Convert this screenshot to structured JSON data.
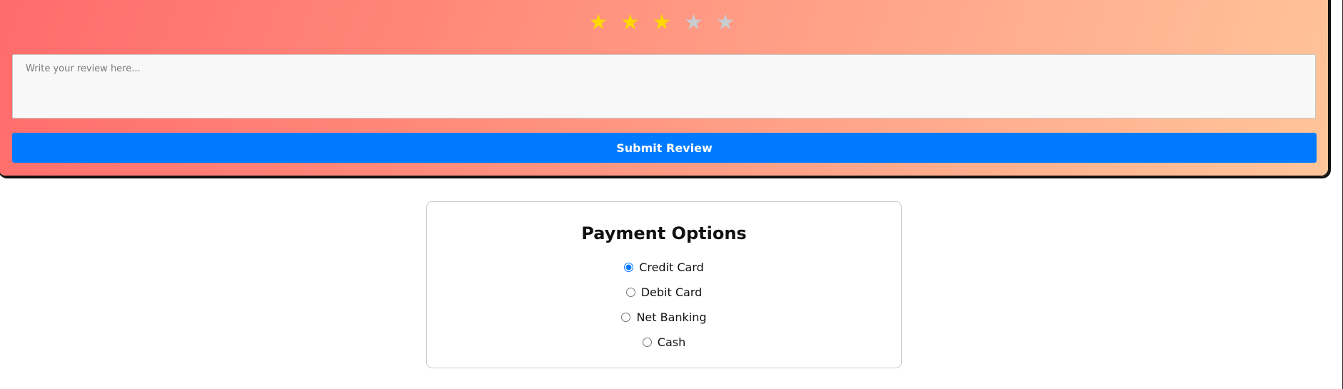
{
  "review": {
    "stars": {
      "rating": 3,
      "max": 5,
      "glyph": "★",
      "filled_color": "#FFD700",
      "empty_color": "#C9CCD1"
    },
    "textarea": {
      "placeholder": "Write your review here...",
      "value": ""
    },
    "submit_label": "Submit Review",
    "gradient_start": "#FF6B6B",
    "gradient_end": "#FFC59A",
    "button_color": "#007BFF"
  },
  "payment": {
    "title": "Payment Options",
    "selected": "credit-card",
    "options": [
      {
        "id": "credit-card",
        "label": "Credit Card"
      },
      {
        "id": "debit-card",
        "label": "Debit Card"
      },
      {
        "id": "net-banking",
        "label": "Net Banking"
      },
      {
        "id": "cash",
        "label": "Cash"
      }
    ]
  }
}
